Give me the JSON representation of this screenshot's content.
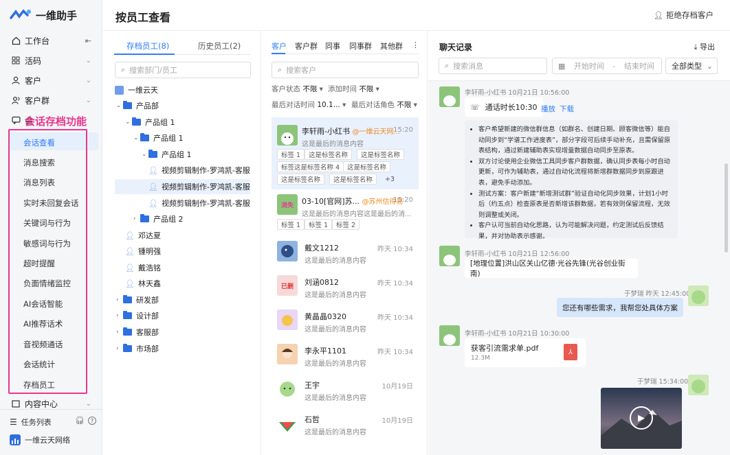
{
  "app": {
    "name": "一维助手"
  },
  "sidebar": {
    "items": [
      {
        "label": "工作台",
        "icon": "home-icon"
      },
      {
        "label": "活码",
        "icon": "grid-icon"
      },
      {
        "label": "客户",
        "icon": "user-icon"
      },
      {
        "label": "客户群",
        "icon": "users-icon"
      },
      {
        "label": "会",
        "icon": "chat-icon"
      }
    ],
    "annotation": "会话存档功能",
    "sub_items": [
      "会话查看",
      "消息搜索",
      "消息列表",
      "实时未回复会话",
      "关键词与行为",
      "敏感词与行为",
      "超时提醒",
      "负面情绪监控",
      "AI会话智能",
      "AI推荐话术",
      "音视频通话",
      "会话统计",
      "存档员工"
    ],
    "content_center": "内容中心",
    "task_list": "任务列表",
    "org_name": "一维云天网络"
  },
  "header": {
    "title": "按员工查看",
    "reject_btn": "拒绝存档客户"
  },
  "staff": {
    "tabs": [
      "存档员工(8)",
      "历史员工(2)"
    ],
    "search_placeholder": "搜索部门/员工",
    "tree": [
      {
        "label": "一维云天"
      },
      {
        "label": "产品部"
      },
      {
        "label": "产品组 1"
      },
      {
        "label": "产品组 1"
      },
      {
        "label": "产品组 1"
      },
      {
        "label": "视频剪辑制作-罗鸿凯-客服小录"
      },
      {
        "label": "视频剪辑制作-罗鸿凯-客服小录"
      },
      {
        "label": "视频剪辑制作-罗鸿凯-客服小录"
      },
      {
        "label": "产品组 2"
      },
      {
        "label": "邓达夏"
      },
      {
        "label": "锺明强"
      },
      {
        "label": "戴浩铭"
      },
      {
        "label": "林天鑫"
      },
      {
        "label": "研发部"
      },
      {
        "label": "设计部"
      },
      {
        "label": "客服部"
      },
      {
        "label": "市场部"
      }
    ]
  },
  "customers": {
    "tabs": [
      "客户",
      "客户群",
      "同事",
      "同事群",
      "其他群"
    ],
    "more": "⋮",
    "search_placeholder": "搜索客户",
    "filters": [
      {
        "label": "客户状态",
        "value": "不限"
      },
      {
        "label": "添加时间",
        "value": "不限"
      },
      {
        "label": "最后对话时间",
        "value": "10.1..."
      },
      {
        "label": "最后对话角色",
        "value": "不限"
      }
    ],
    "list": [
      {
        "name": "李轩雨-小红书",
        "org": "@一维云天网...",
        "time": "15:20",
        "msg": "这是最后的消息内容",
        "tags": [
          "标签 1",
          "这是标签名称",
          "这是标签名称",
          "标签这是标签名称 4",
          "这是标签名称",
          "这是标签名称",
          "这是标签名称",
          "+3"
        ]
      },
      {
        "name": "03-10[官网]苏...",
        "org": "@苏州信得易",
        "time": "15:20",
        "msg": "这是最后的消息内容这是最后的消...",
        "tags": [
          "标签 1",
          "标签 1",
          "标签 2"
        ],
        "avatar_text": "消失"
      },
      {
        "name": "戴文1212",
        "time": "昨天 10:34",
        "msg": "这是最后的消息内容"
      },
      {
        "name": "刘涵0812",
        "time": "昨天 10:34",
        "msg": "这是最后的消息内容",
        "avatar_text": "已删"
      },
      {
        "name": "黄晶晶0320",
        "time": "昨天 10:34",
        "msg": "这是最后的消息内容"
      },
      {
        "name": "李永平1101",
        "time": "昨天 10:34",
        "msg": "这是最后的消息内容"
      },
      {
        "name": "王宇",
        "time": "10月19日",
        "msg": "这是最后的消息内容"
      },
      {
        "name": "石哲",
        "time": "10月19日",
        "msg": "这是最后的消息内容"
      }
    ]
  },
  "chat": {
    "title": "聊天记录",
    "export": "导出",
    "search_placeholder": "搜索消息",
    "date_start": "开始时间",
    "date_sep": "-",
    "date_end": "结束时间",
    "type_select": "全部类型",
    "messages": [
      {
        "meta": "李轩雨-小红书  10月21日 10:56:00",
        "call": "通话时长10:30",
        "play": "播放",
        "download": "下载",
        "bullets": [
          "客户希望新建的微信群信息（如群名、创建日期、顾客微信等）能自动同步到“学谱工作进度表”，部分字段可后续手动补充，且需保留原表结构，通过新建辅助表实现增量数据自动同步至原表。",
          "双方讨论使用企业微信工具同步客户群数据，确认同步表每小时自动更新，可作为辅助表，通过自动化流程将新增群数据同步到原跟进表，避免手动添加。",
          "测试方案：客户新建“新增测试群”验证自动化同步效果，计划1小时后（约五点）检查原表是否新增该群数据，若有效则保留流程，无效则调整或关闭。",
          "客户认可当前自动化思路，认为可能解决问题，约定测试后反馈结果，并对协助表示感谢。"
        ]
      },
      {
        "meta": "李轩雨-小红书  10月21日 12:56:00",
        "text": "[地理位置]洪山区关山亿德·光谷先锋(光谷创业街南)"
      },
      {
        "meta": "于梦瑞  昨天 12:45:00",
        "text": "您还有哪些需求，我帮您处具体方案"
      },
      {
        "meta": "李轩雨-小红书  10月21日 10:30:00",
        "file": "获客引流需求单.pdf",
        "size": "12.3M"
      },
      {
        "meta": "于梦瑞  15:34:00"
      }
    ]
  },
  "colors": {
    "accent": "#2f7cf6",
    "annotation": "#e8378c",
    "org": "#f08a24"
  }
}
